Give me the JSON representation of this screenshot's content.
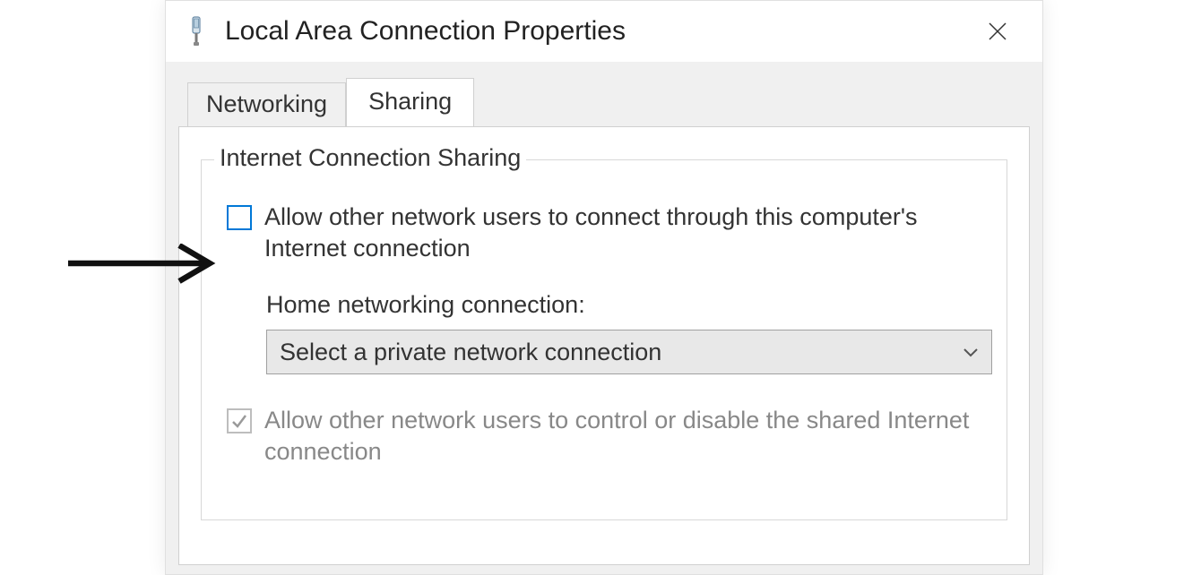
{
  "dialog": {
    "title": "Local Area Connection Properties",
    "tabs": [
      {
        "label": "Networking",
        "active": false
      },
      {
        "label": "Sharing",
        "active": true
      }
    ],
    "group": {
      "title": "Internet Connection Sharing",
      "allowConnect": {
        "checked": false,
        "label": "Allow other network users to connect through this computer's Internet connection"
      },
      "homeNetLabel": "Home networking connection:",
      "homeNetSelect": {
        "value": "Select a private network connection"
      },
      "allowControl": {
        "checked": true,
        "disabled": true,
        "label": "Allow other network users to control or disable the shared Internet connection"
      }
    }
  }
}
